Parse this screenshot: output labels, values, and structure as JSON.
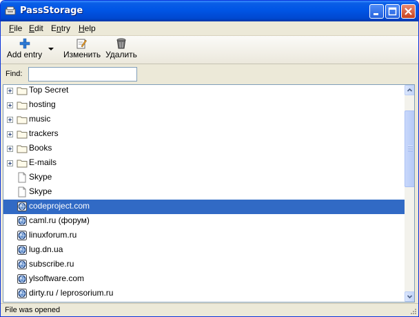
{
  "window": {
    "title": "PassStorage"
  },
  "menu": [
    {
      "label": "File",
      "accel": "F",
      "rest": "ile"
    },
    {
      "label": "Edit",
      "accel": "E",
      "rest": "dit"
    },
    {
      "label": "Entry",
      "accel": "n",
      "pre": "E",
      "rest": "try"
    },
    {
      "label": "Help",
      "accel": "H",
      "rest": "elp"
    }
  ],
  "toolbar": {
    "add_entry": {
      "label": "Add entry",
      "icon": "plus-icon"
    },
    "edit": {
      "label": "Изменить",
      "icon": "edit-icon"
    },
    "delete": {
      "label": "Удалить",
      "icon": "trash-icon"
    }
  },
  "find": {
    "label": "Find:",
    "value": "",
    "placeholder": ""
  },
  "tree": {
    "selected_index": 8,
    "rows": [
      {
        "label": "Top Secret",
        "type": "folder",
        "expandable": true
      },
      {
        "label": "hosting",
        "type": "folder",
        "expandable": true
      },
      {
        "label": "music",
        "type": "folder",
        "expandable": true
      },
      {
        "label": "trackers",
        "type": "folder",
        "expandable": true
      },
      {
        "label": "Books",
        "type": "folder",
        "expandable": true
      },
      {
        "label": "E-mails",
        "type": "folder",
        "expandable": true
      },
      {
        "label": "Skype",
        "type": "file",
        "expandable": false
      },
      {
        "label": "Skype",
        "type": "file",
        "expandable": false
      },
      {
        "label": "codeproject.com",
        "type": "web",
        "expandable": false
      },
      {
        "label": "caml.ru (форум)",
        "type": "web",
        "expandable": false
      },
      {
        "label": "linuxforum.ru",
        "type": "web",
        "expandable": false
      },
      {
        "label": "lug.dn.ua",
        "type": "web",
        "expandable": false
      },
      {
        "label": "subscribe.ru",
        "type": "web",
        "expandable": false
      },
      {
        "label": "ylsoftware.com",
        "type": "web",
        "expandable": false
      },
      {
        "label": "dirty.ru / leprosorium.ru",
        "type": "web",
        "expandable": false
      }
    ]
  },
  "status": {
    "text": "File was opened"
  },
  "colors": {
    "titlebar": "#0055e5",
    "selection": "#316ac5",
    "chrome": "#ece9d8"
  }
}
